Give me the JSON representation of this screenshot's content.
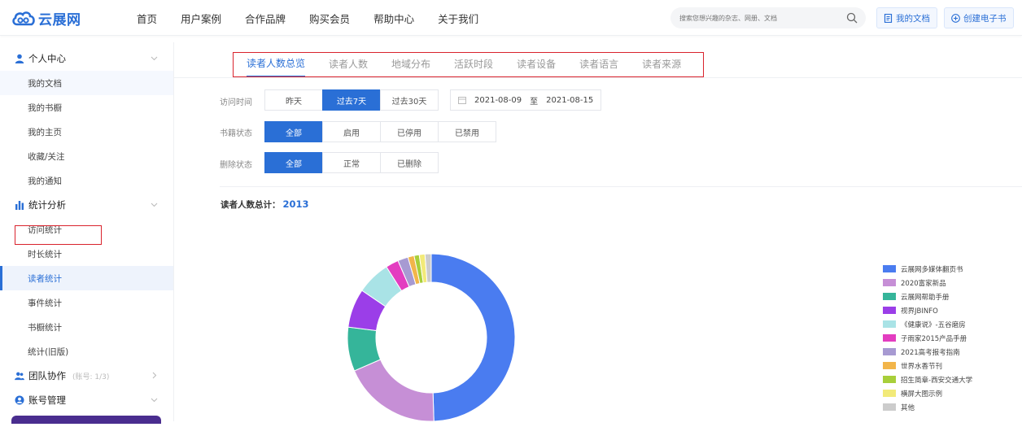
{
  "brand": {
    "name": "云展网",
    "color": "#2a6fd6"
  },
  "nav": [
    "首页",
    "用户案例",
    "合作品牌",
    "购买会员",
    "帮助中心",
    "关于我们"
  ],
  "search": {
    "placeholder": "搜索您想兴趣的杂志、网册、文档"
  },
  "top_buttons": {
    "my_docs": "我的文档",
    "create": "创建电子书"
  },
  "sidebar": {
    "personal": {
      "label": "个人中心",
      "items": [
        "我的文档",
        "我的书橱",
        "我的主页",
        "收藏/关注",
        "我的通知"
      ]
    },
    "stats": {
      "label": "统计分析",
      "items": [
        "访问统计",
        "时长统计",
        "读者统计",
        "事件统计",
        "书橱统计",
        "统计(旧版)"
      ]
    },
    "team": {
      "label": "团队协作",
      "sub": "(账号: 1/3)"
    },
    "account": {
      "label": "账号管理"
    }
  },
  "tabs": [
    "读者人数总览",
    "读者人数",
    "地域分布",
    "活跃时段",
    "读者设备",
    "读者语言",
    "读者来源"
  ],
  "filters": {
    "visit_time": {
      "label": "访问时间",
      "options": [
        "昨天",
        "过去7天",
        "过去30天"
      ],
      "selected": "过去7天",
      "date_start": "2021-08-09",
      "date_sep": "至",
      "date_end": "2021-08-15"
    },
    "book_status": {
      "label": "书籍状态",
      "options": [
        "全部",
        "启用",
        "已停用",
        "已禁用"
      ],
      "selected": "全部"
    },
    "delete_status": {
      "label": "删除状态",
      "options": [
        "全部",
        "正常",
        "已删除"
      ],
      "selected": "全部"
    }
  },
  "total": {
    "label": "读者人数总计：",
    "value": "2013"
  },
  "chart_data": {
    "type": "pie",
    "donut": true,
    "title": "",
    "series": [
      {
        "name": "云展网多媒体翻页书",
        "value": 49.5,
        "color": "#4a7cf0"
      },
      {
        "name": "2020富家新品",
        "value": 19.0,
        "color": "#c68fd6"
      },
      {
        "name": "云展网帮助手册",
        "value": 8.5,
        "color": "#35b59a"
      },
      {
        "name": "视界JBINFO",
        "value": 7.5,
        "color": "#9b3ee8"
      },
      {
        "name": "《健康说》-五谷磨房",
        "value": 6.5,
        "color": "#a9e3e6"
      },
      {
        "name": "子雨家2015产品手册",
        "value": 2.5,
        "color": "#e33dc0"
      },
      {
        "name": "2021高考报考指南",
        "value": 2.0,
        "color": "#a79ad2"
      },
      {
        "name": "世界水香节刊",
        "value": 1.2,
        "color": "#f2b54a"
      },
      {
        "name": "招生简章-西安交通大学",
        "value": 1.0,
        "color": "#a8cf3a"
      },
      {
        "name": "横屏大图示例",
        "value": 1.1,
        "color": "#f2ea79"
      },
      {
        "name": "其他",
        "value": 1.2,
        "color": "#cccccc"
      }
    ]
  }
}
